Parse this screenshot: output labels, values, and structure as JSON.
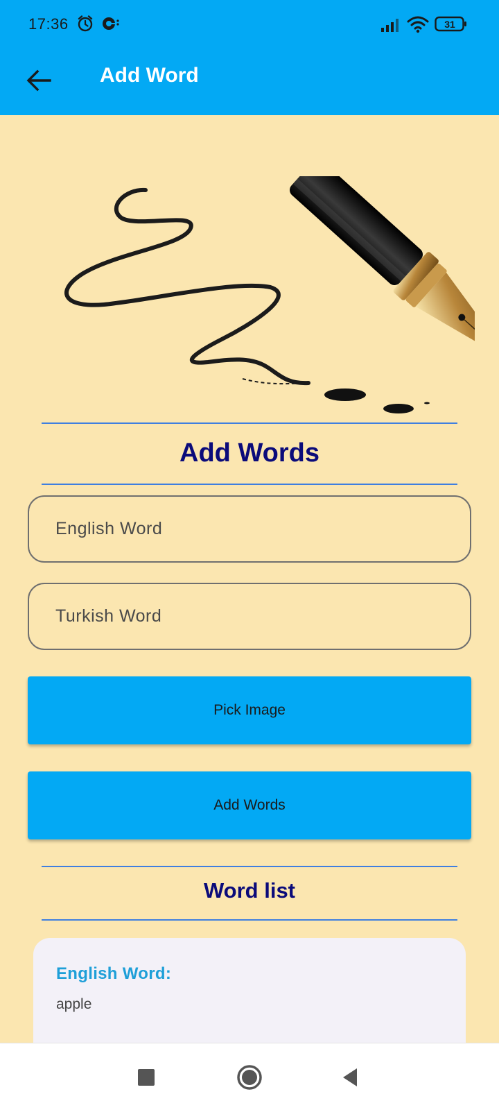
{
  "status_bar": {
    "time": "17:36",
    "battery": "31",
    "icons": [
      "alarm-icon",
      "sync-notification-icon",
      "signal-icon",
      "wifi-icon",
      "battery-icon"
    ]
  },
  "app_bar": {
    "title": "Add Word",
    "back_icon": "arrow-back-icon"
  },
  "main": {
    "illustration": "fountain-pen-writing-illustration",
    "heading": "Add Words",
    "english_field": {
      "placeholder": "English Word",
      "value": ""
    },
    "turkish_field": {
      "placeholder": "Turkish Word",
      "value": ""
    },
    "pick_image_label": "Pick Image",
    "add_words_label": "Add Words",
    "list_heading": "Word list",
    "word_card": {
      "label": "English Word:",
      "value": "apple"
    }
  },
  "nav_bar": {
    "icons": [
      "recents-square-icon",
      "home-circle-icon",
      "back-triangle-icon"
    ]
  },
  "colors": {
    "primary": "#03A9F4",
    "background": "#FBE6B0",
    "heading": "#0B0B7A",
    "divider": "#3F7FE0",
    "card_label": "#1E9FD8",
    "card_bg": "#F3F1F8"
  }
}
